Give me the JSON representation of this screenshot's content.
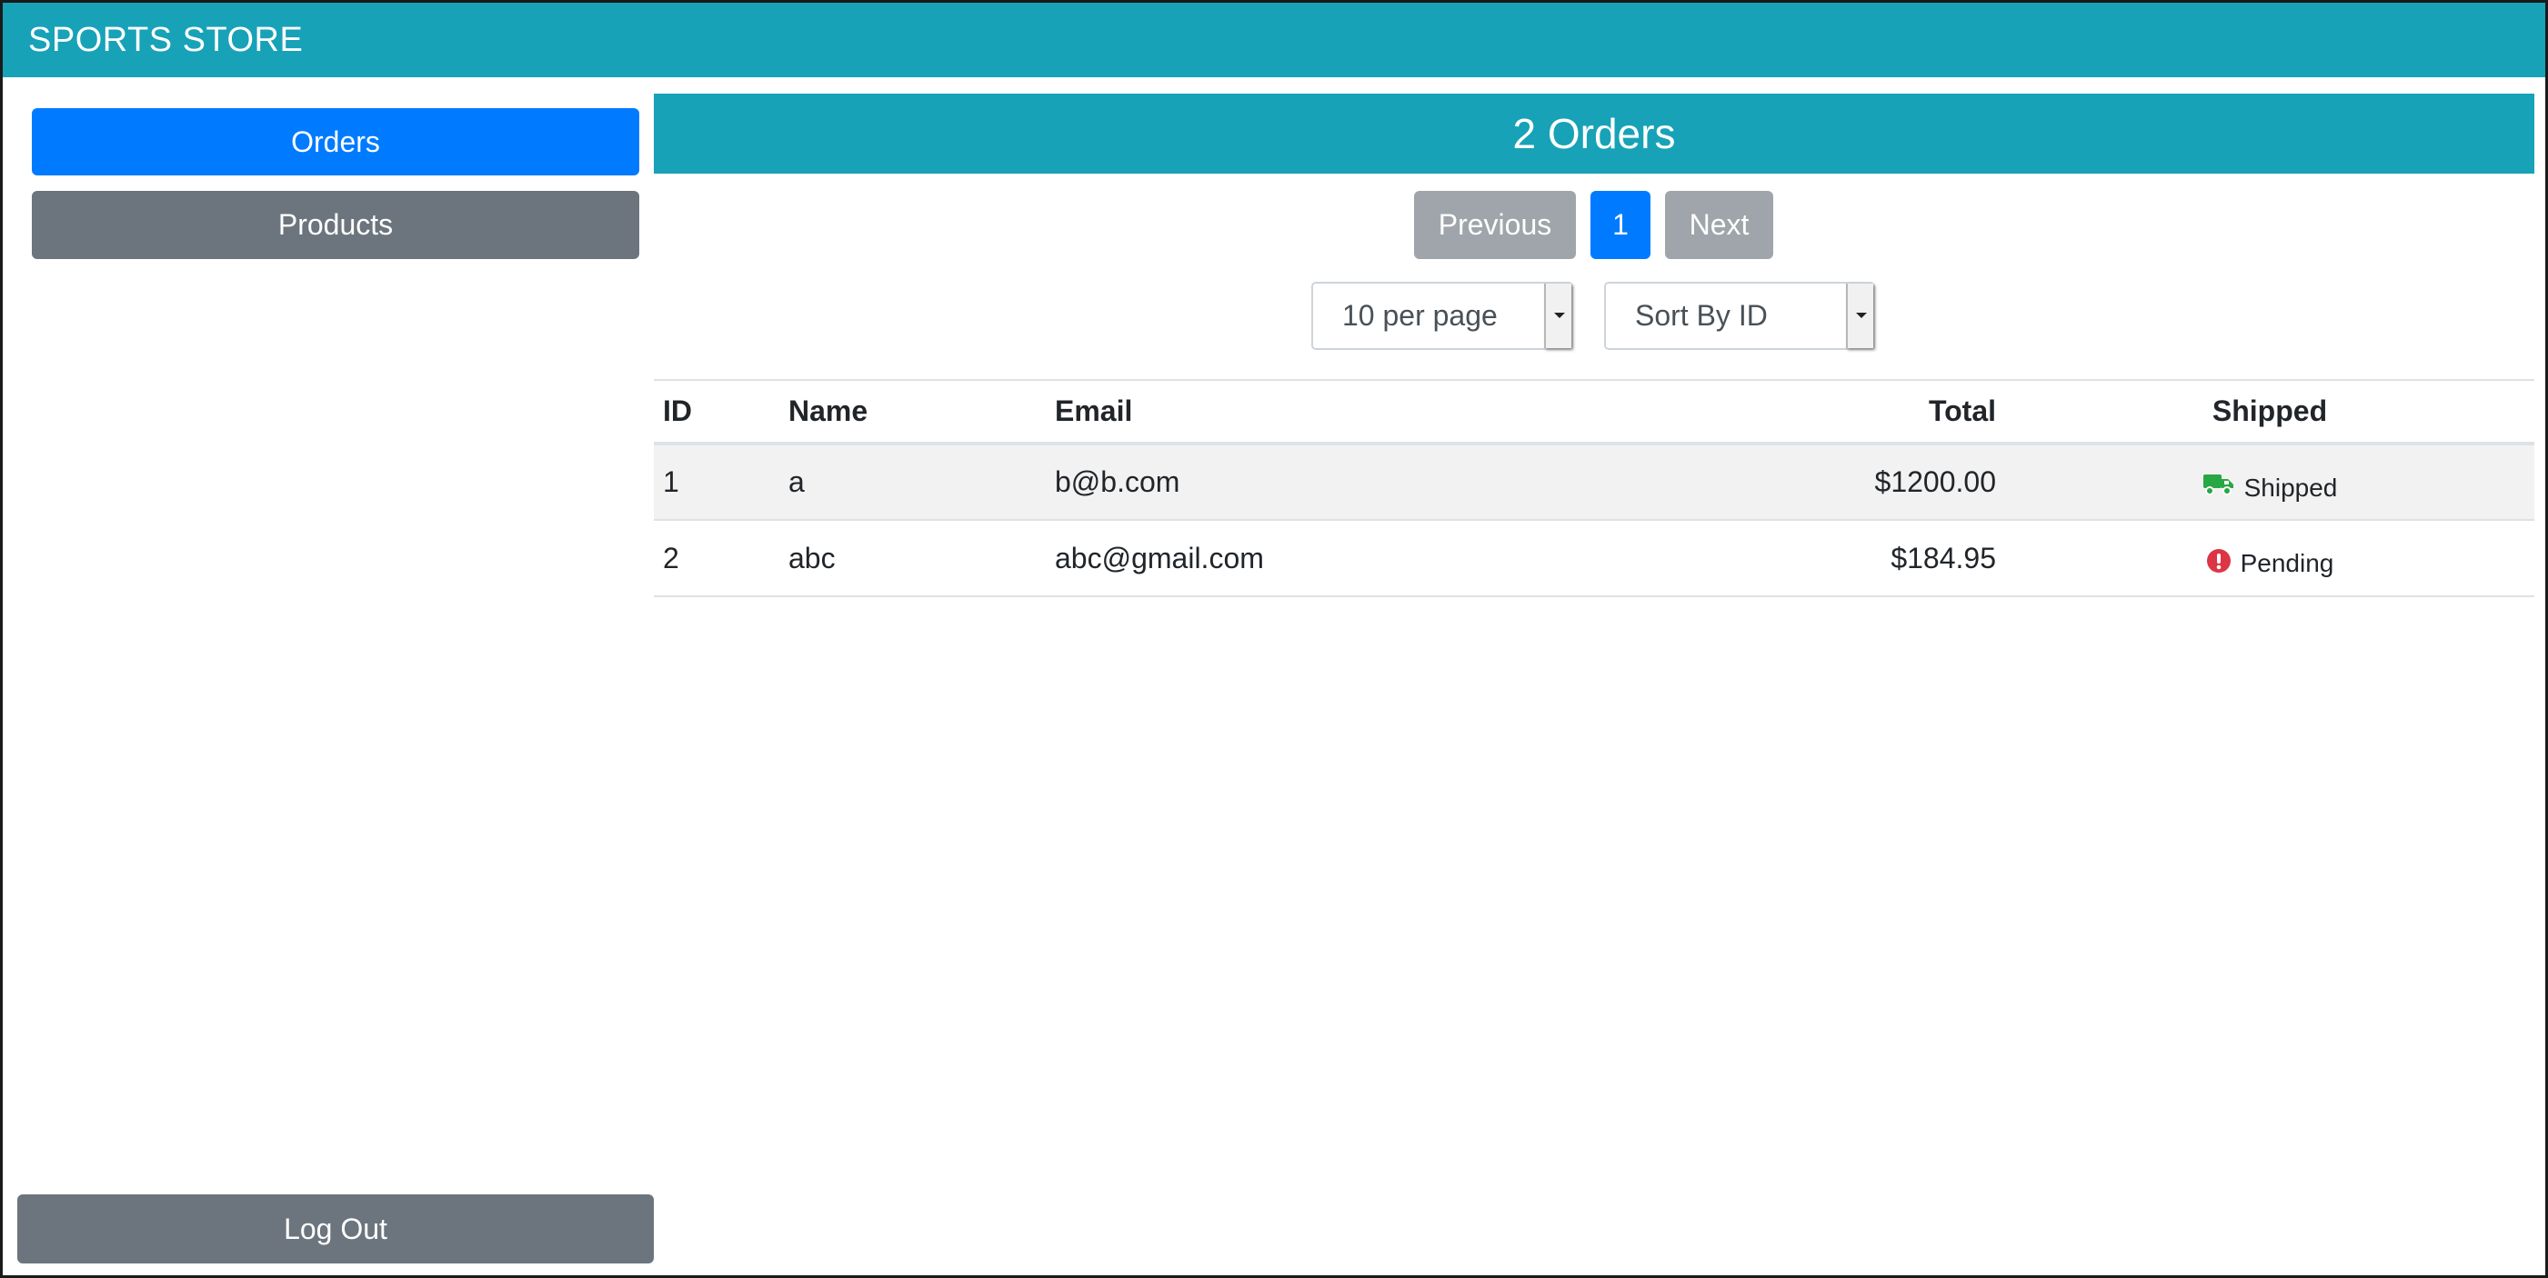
{
  "app": {
    "brand": "SPORTS STORE"
  },
  "sidebar": {
    "items": [
      {
        "label": "Orders",
        "active": true
      },
      {
        "label": "Products",
        "active": false
      }
    ],
    "logout_label": "Log Out"
  },
  "main": {
    "header": "2 Orders",
    "pagination": {
      "previous": "Previous",
      "current": "1",
      "next": "Next"
    },
    "page_size_select": {
      "value": "10 per page"
    },
    "sort_select": {
      "value": "Sort By ID"
    },
    "table": {
      "columns": [
        "ID",
        "Name",
        "Email",
        "Total",
        "Shipped"
      ],
      "rows": [
        {
          "id": "1",
          "name": "a",
          "email": "b@b.com",
          "total": "$1200.00",
          "status": "Shipped",
          "status_icon": "truck-icon"
        },
        {
          "id": "2",
          "name": "abc",
          "email": "abc@gmail.com",
          "total": "$184.95",
          "status": "Pending",
          "status_icon": "exclamation-circle-icon"
        }
      ]
    }
  },
  "colors": {
    "brand": "#17a2b8",
    "primary": "#007bff",
    "secondary": "#6c757d",
    "shipped": "#28a745",
    "pending": "#dc3545"
  }
}
